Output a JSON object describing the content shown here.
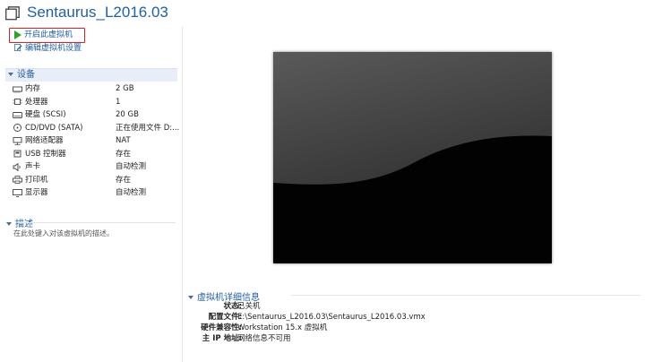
{
  "vm": {
    "title": "Sentaurus_L2016.03"
  },
  "actions": {
    "start": "开启此虚拟机",
    "edit": "编辑虚拟机设置"
  },
  "devices": {
    "heading": "设备",
    "items": [
      {
        "name": "内存",
        "value": "2 GB",
        "icon": "memory-icon"
      },
      {
        "name": "处理器",
        "value": "1",
        "icon": "processor-icon"
      },
      {
        "name": "硬盘 (SCSI)",
        "value": "20 GB",
        "icon": "hard-disk-icon"
      },
      {
        "name": "CD/DVD (SATA)",
        "value": "正在使用文件 D:...",
        "icon": "cd-dvd-icon"
      },
      {
        "name": "网络适配器",
        "value": "NAT",
        "icon": "network-adapter-icon"
      },
      {
        "name": "USB 控制器",
        "value": "存在",
        "icon": "usb-controller-icon"
      },
      {
        "name": "声卡",
        "value": "自动检测",
        "icon": "sound-card-icon"
      },
      {
        "name": "打印机",
        "value": "存在",
        "icon": "printer-icon"
      },
      {
        "name": "显示器",
        "value": "自动检测",
        "icon": "display-icon"
      }
    ]
  },
  "description": {
    "heading": "描述",
    "placeholder": "在此处键入对该虚拟机的描述。"
  },
  "details": {
    "heading": "虚拟机详细信息",
    "rows": [
      {
        "key": "状态:",
        "value": "已关机"
      },
      {
        "key": "配置文件:",
        "value": "E:\\Sentaurus_L2016.03\\Sentaurus_L2016.03.vmx"
      },
      {
        "key": "硬件兼容性:",
        "value": "Workstation 15.x 虚拟机"
      },
      {
        "key": "主 IP 地址:",
        "value": "网络信息不可用"
      }
    ]
  },
  "colors": {
    "accent": "#1f5fa8",
    "highlight_border": "#e02020",
    "play": "#2aa52a"
  }
}
